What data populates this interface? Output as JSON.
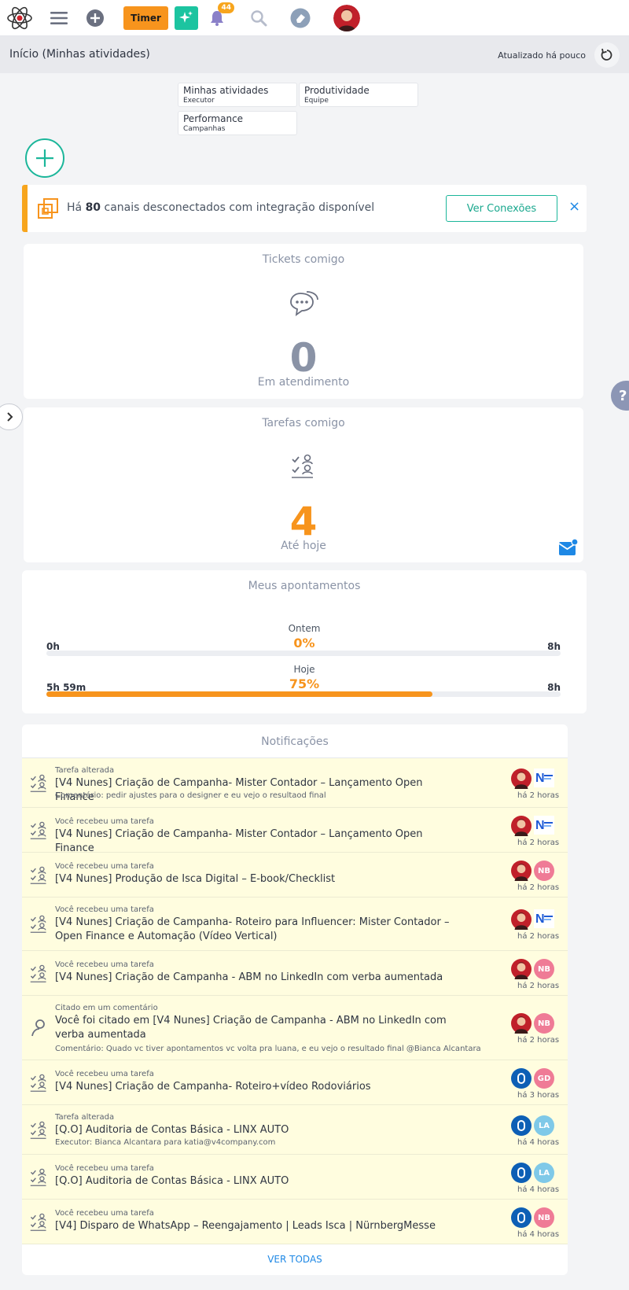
{
  "topbar": {
    "timer_label": "Timer",
    "notification_count": "44",
    "icons": [
      "atom-logo-icon",
      "menu-icon",
      "plus-icon",
      "sparkle-icon",
      "bell-icon",
      "search-icon",
      "eraser-icon",
      "user-avatar"
    ]
  },
  "header": {
    "title": "Início (Minhas atividades)",
    "updated": "Atualizado há pouco"
  },
  "views": [
    {
      "label": "Minhas atividades",
      "sub": "Executor"
    },
    {
      "label": "Produtividade",
      "sub": "Equipe"
    },
    {
      "label": "Performance",
      "sub": "Campanhas"
    }
  ],
  "alert": {
    "prefix": "Há ",
    "count": "80",
    "suffix": " canais desconectados com integração disponível",
    "button": "Ver Conexões",
    "close": "×"
  },
  "tickets": {
    "title": "Tickets comigo",
    "value": "0",
    "subtitle": "Em atendimento"
  },
  "tasks": {
    "title": "Tarefas comigo",
    "value": "4",
    "subtitle": "Até hoje"
  },
  "appointments": {
    "title": "Meus apontamentos",
    "yesterday": {
      "caption": "Ontem",
      "percent": "0%",
      "left": "0h",
      "right": "8h",
      "fill": 0
    },
    "today": {
      "caption": "Hoje",
      "percent": "75%",
      "left": "5h 59m",
      "right": "8h",
      "fill": 0.75
    }
  },
  "notifications": {
    "title": "Notificações",
    "see_all": "VER TODAS",
    "items": [
      {
        "type": "Tarefa alterada",
        "title": "[V4 Nunes] Criação de Campanha- Mister Contador – Lançamento Open Finance",
        "comment": "Comentário: pedir ajustes para o designer e eu vejo o resultaod final",
        "time": "há 2 horas",
        "icon": "task-icon",
        "avatar2": "logo",
        "avatar2_text": ""
      },
      {
        "type": "Você recebeu uma tarefa",
        "title": "[V4 Nunes] Criação de Campanha- Mister Contador – Lançamento Open Finance",
        "comment": "",
        "time": "há 2 horas",
        "icon": "task-icon",
        "avatar2": "logo",
        "avatar2_text": ""
      },
      {
        "type": "Você recebeu uma tarefa",
        "title": "[V4 Nunes] Produção de Isca Digital – E-book/Checklist",
        "comment": "",
        "time": "há 2 horas",
        "icon": "task-icon",
        "avatar2": "NB",
        "avatar2_text": "NB"
      },
      {
        "type": "Você recebeu uma tarefa",
        "title": "[V4 Nunes] Criação de Campanha- Roteiro para Influencer: Mister Contador – Open Finance e Automação (Vídeo Vertical)",
        "comment": "",
        "time": "há 2 horas",
        "icon": "task-icon",
        "avatar2": "logo",
        "avatar2_text": ""
      },
      {
        "type": "Você recebeu uma tarefa",
        "title": "[V4 Nunes] Criação de Campanha - ABM no LinkedIn com verba aumentada",
        "comment": "",
        "time": "há 2 horas",
        "icon": "task-icon",
        "avatar2": "NB",
        "avatar2_text": "NB"
      },
      {
        "type": "Citado em um comentário",
        "title": "Você foi citado em [V4 Nunes] Criação de Campanha - ABM no LinkedIn com verba aumentada",
        "comment": "Comentário: Quado vc tiver apontamentos vc volta pra luana, e eu vejo o resultado final @Bianca Alcantara",
        "time": "há 2 horas",
        "icon": "mention-icon",
        "avatar2": "NB",
        "avatar2_text": "NB"
      },
      {
        "type": "Você recebeu uma tarefa",
        "title": "[V4 Nunes] Criação de Campanha- Roteiro+vídeo Rodoviários",
        "comment": "",
        "time": "há 3 horas",
        "icon": "task-icon",
        "avatar1": "blue",
        "avatar2": "GD",
        "avatar2_text": "GD"
      },
      {
        "type": "Tarefa alterada",
        "title": "[Q.O] Auditoria de Contas Básica - LINX AUTO",
        "comment": "Executor: Bianca Alcantara para katia@v4company.com",
        "time": "há 4 horas",
        "icon": "task-icon",
        "avatar1": "blue",
        "avatar2": "LA",
        "avatar2_text": "LA"
      },
      {
        "type": "Você recebeu uma tarefa",
        "title": "[Q.O] Auditoria de Contas Básica - LINX AUTO",
        "comment": "",
        "time": "há 4 horas",
        "icon": "task-icon",
        "avatar1": "blue",
        "avatar2": "LA",
        "avatar2_text": "LA"
      },
      {
        "type": "Você recebeu uma tarefa",
        "title": "[V4] Disparo de WhatsApp – Reengajamento | Leads Isca | NürnbergMesse",
        "comment": "",
        "time": "há 4 horas",
        "icon": "task-icon",
        "avatar1": "blue",
        "avatar2": "NB",
        "avatar2_text": "NB"
      }
    ]
  },
  "colors": {
    "accent": "#1bb69a",
    "orange": "#f7941d",
    "highlight": "#fffddf",
    "muted": "#8a93a6"
  }
}
